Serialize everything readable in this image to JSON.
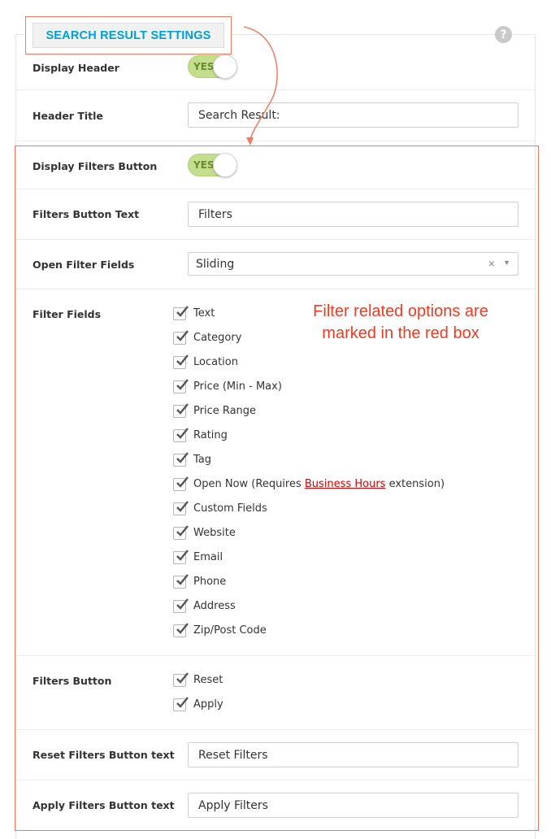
{
  "section_tab": {
    "label": "SEARCH RESULT SETTINGS"
  },
  "help_icon": {
    "glyph": "?"
  },
  "rows": {
    "display_header": {
      "label": "Display Header",
      "toggle": "YES"
    },
    "header_title": {
      "label": "Header Title",
      "value": "Search Result:"
    },
    "display_filters_button": {
      "label": "Display Filters Button",
      "toggle": "YES"
    },
    "filters_button_text": {
      "label": "Filters Button Text",
      "value": "Filters"
    },
    "open_filter_fields": {
      "label": "Open Filter Fields",
      "value": "Sliding",
      "clear": "×",
      "arrow": "▼"
    },
    "filter_fields": {
      "label": "Filter Fields",
      "items": [
        "Text",
        "Category",
        "Location",
        "Price (Min - Max)",
        "Price Range",
        "Rating",
        "Tag",
        "Open Now (Requires ",
        "Custom Fields",
        "Website",
        "Email",
        "Phone",
        "Address",
        "Zip/Post Code"
      ],
      "open_now_link": "Business Hours",
      "open_now_suffix": " extension)"
    },
    "filters_button": {
      "label": "Filters Button",
      "items": [
        "Reset",
        "Apply"
      ]
    },
    "reset_text": {
      "label": "Reset Filters Button text",
      "value": "Reset Filters"
    },
    "apply_text": {
      "label": "Apply Filters Button text",
      "value": "Apply Filters"
    }
  },
  "annotation": {
    "line1": "Filter related options are",
    "line2": "marked in the red box"
  },
  "colors": {
    "accent_blue": "#00a0d2",
    "annotation_red": "#f1391f",
    "toggle_green": "#c3de8c",
    "link_red": "#d40000"
  }
}
